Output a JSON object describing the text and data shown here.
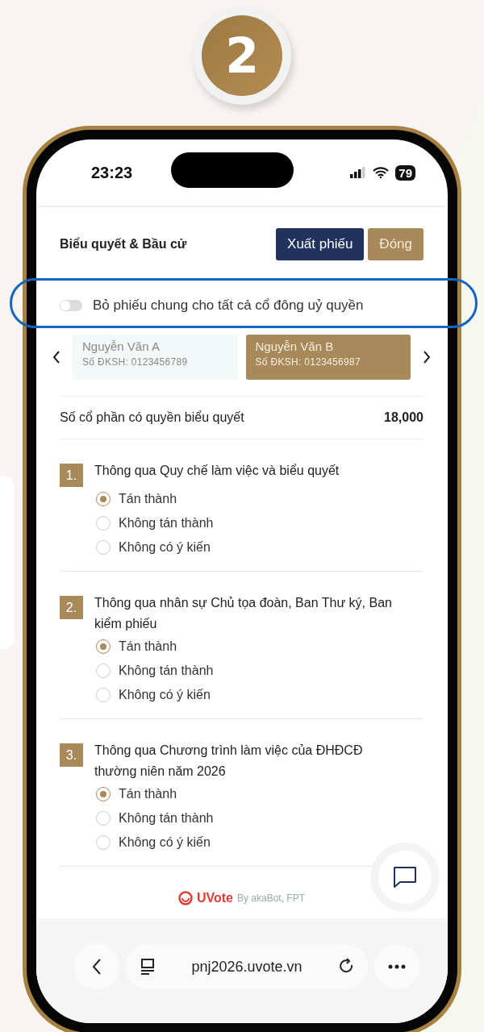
{
  "step_badge": "2",
  "status_bar": {
    "time": "23:23",
    "battery": "79"
  },
  "header": {
    "title": "Biểu quyết & Bầu cử",
    "buttons": [
      {
        "label": "Xuất phiếu",
        "kind": "primary"
      },
      {
        "label": "Đóng",
        "kind": "secondary"
      }
    ]
  },
  "proxy_toggle": {
    "label": "Bỏ phiếu chung cho tất cả cổ đông uỷ quyền",
    "on": false,
    "highlighted": true
  },
  "shareholders": [
    {
      "name": "Nguyễn Văn A",
      "id": "Số ĐKSH: 0123456789",
      "selected": false
    },
    {
      "name": "Nguyễn Văn B",
      "id": "Số ĐKSH: 0123456987",
      "selected": true
    }
  ],
  "voting_shares": {
    "label": "Số cổ phần có quyền biểu quyết",
    "value": "18,000"
  },
  "questions": [
    {
      "number": "1.",
      "title": "Thông qua Quy chế làm việc và biểu quyết",
      "options": [
        {
          "label": "Tán thành",
          "selected": true
        },
        {
          "label": "Không tán thành",
          "selected": false
        },
        {
          "label": "Không có ý kiến",
          "selected": false
        }
      ]
    },
    {
      "number": "2.",
      "title": "Thông qua nhân sự Chủ tọa đoàn, Ban Thư ký, Ban kiểm phiếu",
      "options": [
        {
          "label": "Tán thành",
          "selected": true
        },
        {
          "label": "Không tán thành",
          "selected": false
        },
        {
          "label": "Không có ý kiến",
          "selected": false
        }
      ]
    },
    {
      "number": "3.",
      "title": "Thông qua Chương trình làm việc của ĐHĐCĐ thường niên năm 2026",
      "options": [
        {
          "label": "Tán thành",
          "selected": true
        },
        {
          "label": "Không tán thành",
          "selected": false
        },
        {
          "label": "Không có ý kiến",
          "selected": false
        }
      ]
    }
  ],
  "footer": {
    "brand": "UVote",
    "tagline": "By akaBot, FPT"
  },
  "browser": {
    "url": "pnj2026.uvote.vn"
  }
}
